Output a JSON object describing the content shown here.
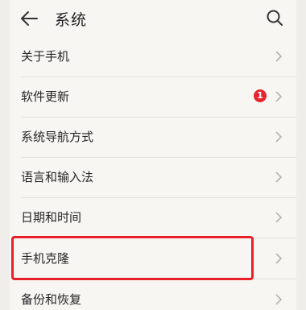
{
  "header": {
    "title": "系统",
    "back_icon": "back-arrow-icon",
    "search_icon": "search-icon"
  },
  "settings_items": [
    {
      "label": "关于手机"
    },
    {
      "label": "软件更新",
      "badge": "1"
    },
    {
      "label": "系统导航方式"
    },
    {
      "label": "语言和输入法"
    },
    {
      "label": "日期和时间"
    },
    {
      "label": "手机克隆"
    },
    {
      "label": "备份和恢复"
    }
  ],
  "colors": {
    "badge": "#e3262f",
    "highlight_box": "#e8202a",
    "background": "#f7f6f3"
  }
}
